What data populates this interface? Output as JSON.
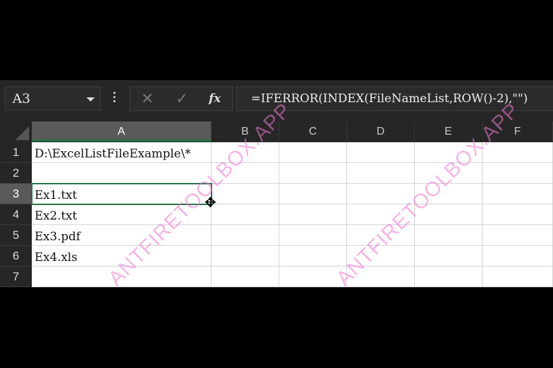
{
  "formula_bar": {
    "name_box": "A3",
    "more_icon": "vertical-dots-icon",
    "cancel_icon": "✕",
    "enter_icon": "✓",
    "fx_label": "fx",
    "formula": "=IFERROR(INDEX(FileNameList,ROW()-2),\"\")"
  },
  "columns": [
    "A",
    "B",
    "C",
    "D",
    "E",
    "F"
  ],
  "selected_cell": "A3",
  "rows": [
    {
      "num": "1",
      "A": "D:\\ExcelListFileExample\\*"
    },
    {
      "num": "2",
      "A": ""
    },
    {
      "num": "3",
      "A": "Ex1.txt"
    },
    {
      "num": "4",
      "A": "Ex2.txt"
    },
    {
      "num": "5",
      "A": "Ex3.pdf"
    },
    {
      "num": "6",
      "A": "Ex4.xls"
    },
    {
      "num": "7",
      "A": ""
    }
  ],
  "watermark": "ANTFIRETOOLBOX.APP",
  "colors": {
    "accent": "#217346",
    "watermark": "#eb78d2"
  }
}
